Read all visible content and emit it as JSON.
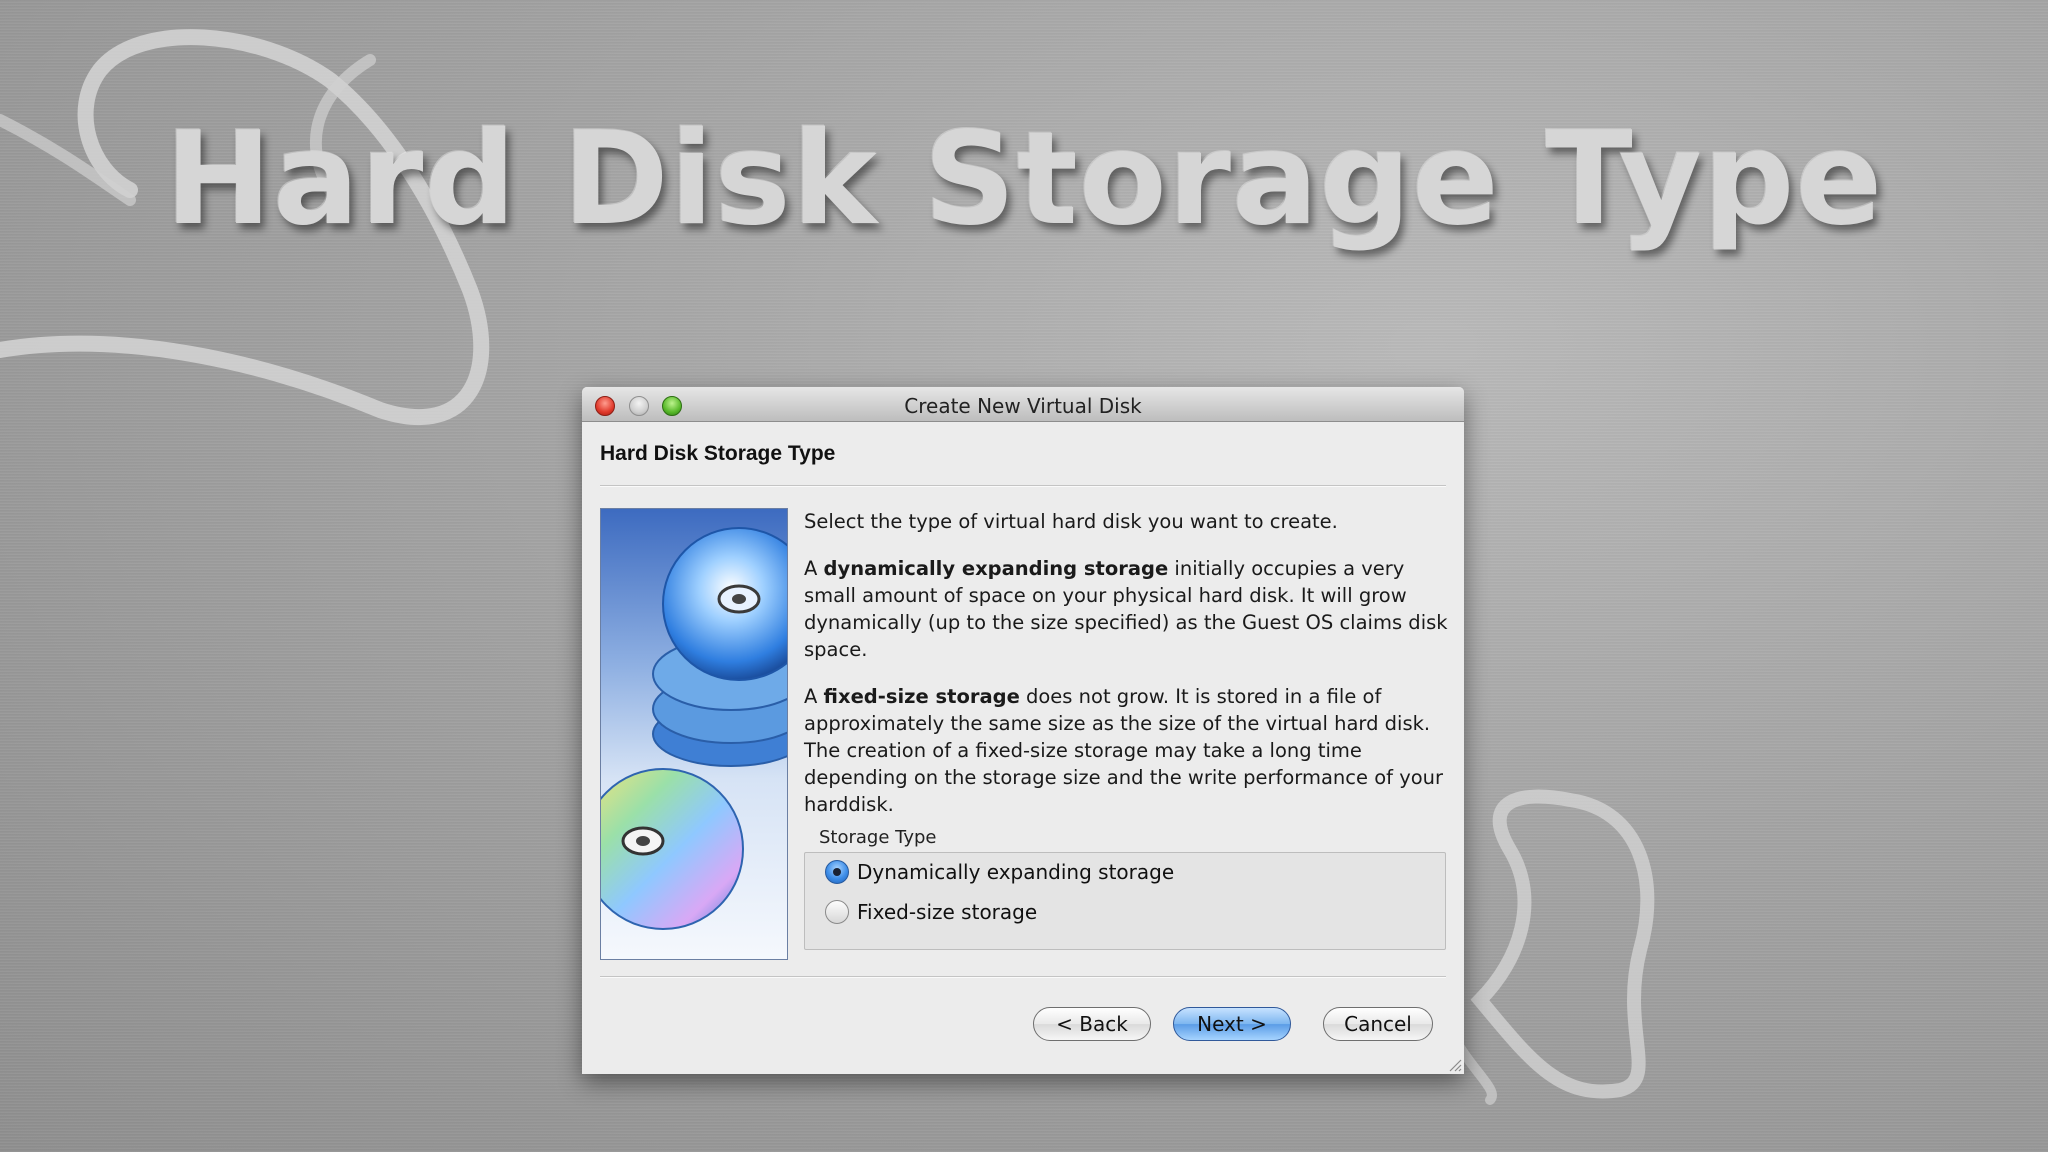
{
  "slide": {
    "title": "Hard Disk Storage Type"
  },
  "window": {
    "title": "Create New Virtual Disk"
  },
  "page": {
    "heading": "Hard Disk Storage Type"
  },
  "content": {
    "intro": "Select the type of virtual hard disk you want to create.",
    "p2_prefix": "A ",
    "p2_bold": "dynamically expanding storage",
    "p2_rest": " initially occupies a very small amount of space on your physical hard disk. It will grow dynamically (up to the size specified) as the Guest OS claims disk space.",
    "p3_prefix": "A ",
    "p3_bold": "fixed-size storage",
    "p3_rest": " does not grow. It is stored in a file of approximately the same size as the size of the virtual hard disk. The creation of a fixed-size storage may take a long time depending on the storage size and the write performance of your harddisk."
  },
  "storage_type": {
    "label": "Storage Type",
    "options": [
      {
        "label": "Dynamically expanding storage",
        "selected": true
      },
      {
        "label": "Fixed-size storage",
        "selected": false
      }
    ]
  },
  "buttons": {
    "back": "< Back",
    "next": "Next >",
    "cancel": "Cancel"
  },
  "colors": {
    "default_button": "#5a9ce6",
    "close": "#e0392b",
    "zoom": "#58b92a"
  }
}
